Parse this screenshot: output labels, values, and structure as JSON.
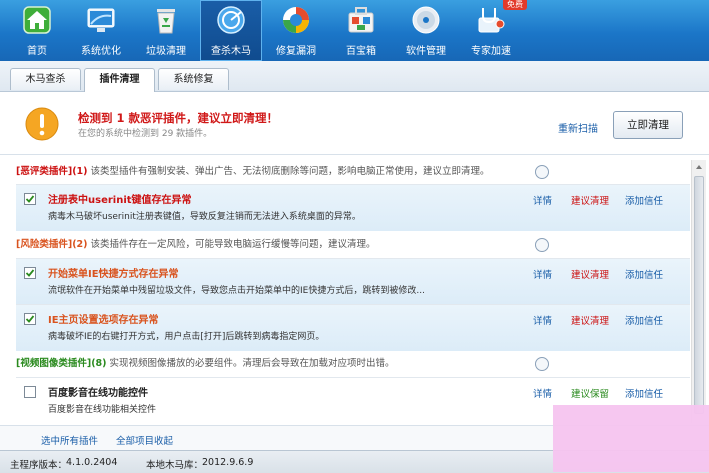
{
  "toolbar": {
    "items": [
      {
        "label": "首页",
        "icon": "home-icon"
      },
      {
        "label": "系统优化",
        "icon": "monitor-icon"
      },
      {
        "label": "垃圾清理",
        "icon": "recycle-bin-icon"
      },
      {
        "label": "查杀木马",
        "icon": "shield-scan-icon"
      },
      {
        "label": "修复漏洞",
        "icon": "repair-icon"
      },
      {
        "label": "百宝箱",
        "icon": "toolbox-icon"
      },
      {
        "label": "软件管理",
        "icon": "disc-icon"
      },
      {
        "label": "专家加速",
        "icon": "stethoscope-icon"
      }
    ],
    "badge": "免费"
  },
  "tabs": [
    {
      "label": "木马查杀"
    },
    {
      "label": "插件清理"
    },
    {
      "label": "系统修复"
    }
  ],
  "alert": {
    "title": "检测到 1 款恶评插件，建议立即清理！",
    "subtitle": "在您的系统中检测到 29 款插件。",
    "rescan": "重新扫描",
    "clean_now": "立即清理"
  },
  "categories": [
    {
      "name": "[恶评类插件]",
      "count": "(1)",
      "desc": "该类型插件有强制安装、弹出广告、无法彻底删除等问题，影响电脑正常使用，建议立即清理。",
      "color": "#cc1111"
    },
    {
      "name": "[风险类插件]",
      "count": "(2)",
      "desc": "该类插件存在一定风险，可能导致电脑运行缓慢等问题，建议清理。",
      "color": "#d9531e"
    },
    {
      "name": "[视频图像类插件]",
      "count": "(8)",
      "desc": "实现视频图像播放的必要组件。清理后会导致在加载对应项时出错。",
      "color": "#2a8a1e"
    }
  ],
  "items": [
    {
      "title": "注册表中userinit键值存在异常",
      "desc": "病毒木马破坏userinit注册表键值，导致反复注销而无法进入系统桌面的异常。",
      "checked": true,
      "title_color": "#cc1111",
      "details": "详情",
      "action": "建议清理",
      "action_color": "#cc1111",
      "trust": "添加信任"
    },
    {
      "title": "开始菜单IE快捷方式存在异常",
      "desc": "流氓软件在开始菜单中残留垃圾文件，导致您点击开始菜单中的IE快捷方式后，跳转到被修改...",
      "checked": true,
      "title_color": "#d9531e",
      "details": "详情",
      "action": "建议清理",
      "action_color": "#cc1111",
      "trust": "添加信任"
    },
    {
      "title": "IE主页设置选项存在异常",
      "desc": "病毒破坏IE的右键打开方式，用户点击[打开]后跳转到病毒指定网页。",
      "checked": true,
      "title_color": "#d9531e",
      "details": "详情",
      "action": "建议清理",
      "action_color": "#cc1111",
      "trust": "添加信任"
    },
    {
      "title": "百度影音在线功能控件",
      "desc": "百度影音在线功能相关控件",
      "checked": false,
      "title_color": "#222222",
      "details": "详情",
      "action": "建议保留",
      "action_color": "#2a8a1e",
      "trust": "添加信任"
    }
  ],
  "footer": {
    "select_all": "选中所有插件",
    "collapse_all": "全部项目收起"
  },
  "status": {
    "version_label": "主程序版本：",
    "version": "4.1.0.2404",
    "db_label": "本地木马库：",
    "db": "2012.9.6.9"
  },
  "colors": {
    "accent": "#1a5ea8",
    "toolbar": "#1b76c8"
  }
}
